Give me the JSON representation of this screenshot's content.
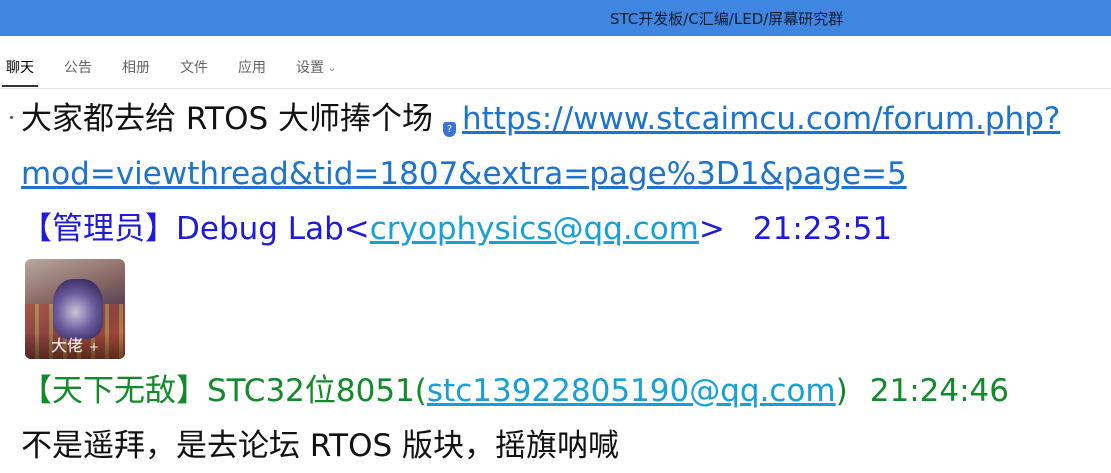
{
  "window": {
    "title": "STC开发板/C汇编/LED/屏幕研究群"
  },
  "tabs": [
    {
      "label": "聊天",
      "active": true
    },
    {
      "label": "公告"
    },
    {
      "label": "相册"
    },
    {
      "label": "文件"
    },
    {
      "label": "应用"
    },
    {
      "label": "设置"
    }
  ],
  "messages": {
    "m1": {
      "text": "大家都去给 RTOS 大师捧个场",
      "link_part1": "https://www.stcaimcu.com/forum.php?",
      "link_part2": "mod=viewthread&tid=1807&extra=page%3D1&page=5"
    },
    "m2": {
      "bracket_open": "【",
      "role": "管理员",
      "bracket_close": "】",
      "name": "Debug Lab",
      "email_open": "<",
      "email": "cryophysics@qq.com",
      "email_close": ">",
      "time": "21:23:51",
      "image_caption": "大佬",
      "image_plus": "+"
    },
    "m3": {
      "bracket_open": "【",
      "role": "天下无敌",
      "bracket_close": "】",
      "name": "STC32位8051",
      "email_open": "(",
      "email": "stc13922805190@qq.com",
      "email_close": ")",
      "time": "21:24:46",
      "text": "不是遥拜，是去论坛 RTOS 版块，摇旗呐喊"
    }
  },
  "colors": {
    "titlebar": "#3f86e0",
    "link": "#1e73cc",
    "admin": "#1f19d9",
    "member": "#118a2a"
  }
}
